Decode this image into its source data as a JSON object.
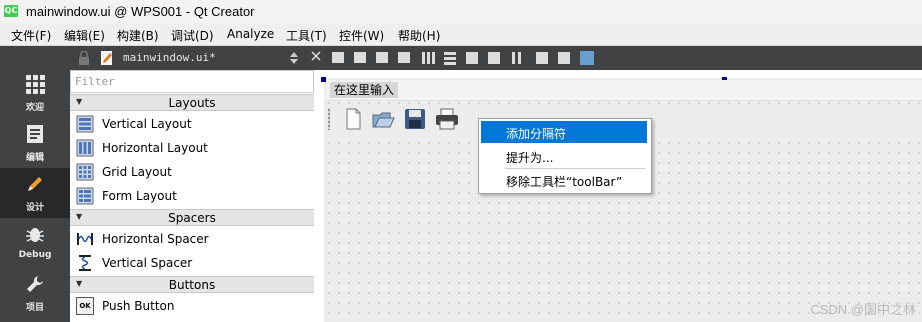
{
  "window": {
    "title": "mainwindow.ui @ WPS001 - Qt Creator",
    "app_icon": "QC"
  },
  "menubar": [
    "文件(F)",
    "编辑(E)",
    "构建(B)",
    "调试(D)",
    "Analyze",
    "工具(T)",
    "控件(W)",
    "帮助(H)"
  ],
  "modes": [
    {
      "label": "欢迎",
      "icon": "grid-icon"
    },
    {
      "label": "编辑",
      "icon": "document-icon"
    },
    {
      "label": "设计",
      "icon": "pencil-icon",
      "active": true
    },
    {
      "label": "Debug",
      "icon": "bug-icon"
    },
    {
      "label": "项目",
      "icon": "wrench-icon"
    }
  ],
  "editor_tab": {
    "filename": "mainwindow.ui*"
  },
  "widget_box": {
    "filter_placeholder": "Filter",
    "categories": [
      {
        "name": "Layouts",
        "items": [
          "Vertical Layout",
          "Horizontal Layout",
          "Grid Layout",
          "Form Layout"
        ]
      },
      {
        "name": "Spacers",
        "items": [
          "Horizontal Spacer",
          "Vertical Spacer"
        ]
      },
      {
        "name": "Buttons",
        "items": [
          "Push Button"
        ]
      }
    ],
    "push_button_icon_text": "OK"
  },
  "form": {
    "menu_placeholder": "在这里输入",
    "toolbar_icons": [
      "new-file-icon",
      "open-folder-icon",
      "save-disk-icon",
      "printer-icon"
    ]
  },
  "context_menu": {
    "items": [
      "添加分隔符",
      "提升为...",
      "移除工具栏“toolBar”"
    ],
    "highlighted": 0,
    "highlight_color": "#0078d7"
  },
  "watermark": "CSDN @国中之林"
}
